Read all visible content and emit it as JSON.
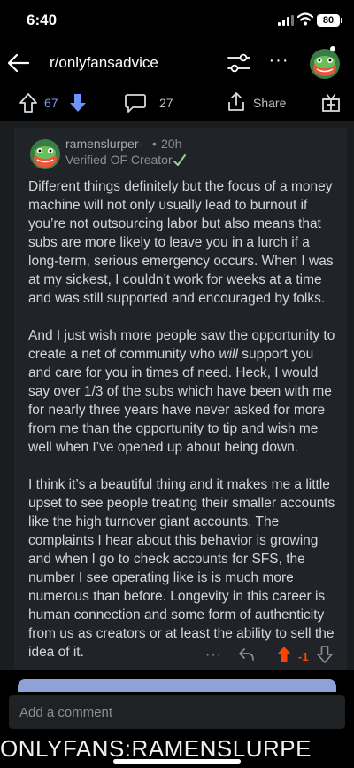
{
  "status_bar": {
    "time": "6:40",
    "battery": "80"
  },
  "nav": {
    "subreddit": "r/onlyfansadvice",
    "more": "···"
  },
  "post_actions": {
    "votes": "67",
    "comments": "27",
    "share": "Share"
  },
  "comment": {
    "author": "ramenslurper-",
    "separator": "•",
    "age": "20h",
    "flair": "Verified OF Creator",
    "p1": "Different things definitely but the focus of a money machine will not only usually lead to burnout if you’re not outsourcing labor but also means that subs are more likely to leave you in a lurch if a long-term, serious emergency occurs. When I was at my sickest, I couldn’t work for weeks at a time and was still supported and encouraged by folks.",
    "p2_a": "And I just wish more people saw the opportunity to create a net of community who ",
    "p2_em": "will",
    "p2_b": " support you and care for you in times of need. Heck, I would say over 1/3 of the subs which have been with me for nearly three years have never asked for more from me than the opportunity to tip and wish me well when I’ve opened up about being down.",
    "p3": "I think it’s a beautiful thing and it makes me a little upset to see people treating their smaller accounts like the high turnover giant accounts. The complaints I hear about this behavior is growing and when I go to check accounts for SFS, the number I see operating like is is much more numerous than before. Longevity in this career is human connection and some form of authenticity from us as creators or at least the ability to sell the idea of it.",
    "more": "···",
    "score": "-1"
  },
  "composer": {
    "placeholder": "Add a comment"
  },
  "watermark": "ONLYFANS:RAMENSLURPE",
  "colors": {
    "accent_blue": "#7a9bf5",
    "upvote_orange": "#ff4500",
    "card_bg": "#202428"
  }
}
